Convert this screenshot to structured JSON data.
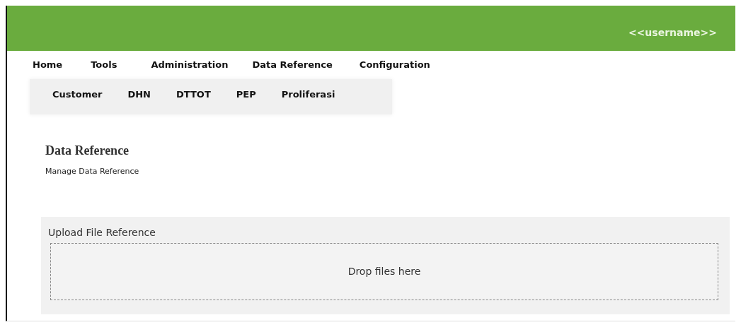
{
  "header": {
    "username": "<<username>>"
  },
  "menu": [
    {
      "label": "Home"
    },
    {
      "label": "Tools"
    },
    {
      "label": "Administration"
    },
    {
      "label": "Data Reference"
    },
    {
      "label": "Configuration"
    }
  ],
  "submenu": [
    {
      "label": "Customer"
    },
    {
      "label": "DHN"
    },
    {
      "label": "DTTOT"
    },
    {
      "label": "PEP"
    },
    {
      "label": "Proliferasi"
    }
  ],
  "page": {
    "title": "Data Reference",
    "subtitle": "Manage Data Reference"
  },
  "upload": {
    "title": "Upload File Reference",
    "dropzone": "Drop files here"
  }
}
